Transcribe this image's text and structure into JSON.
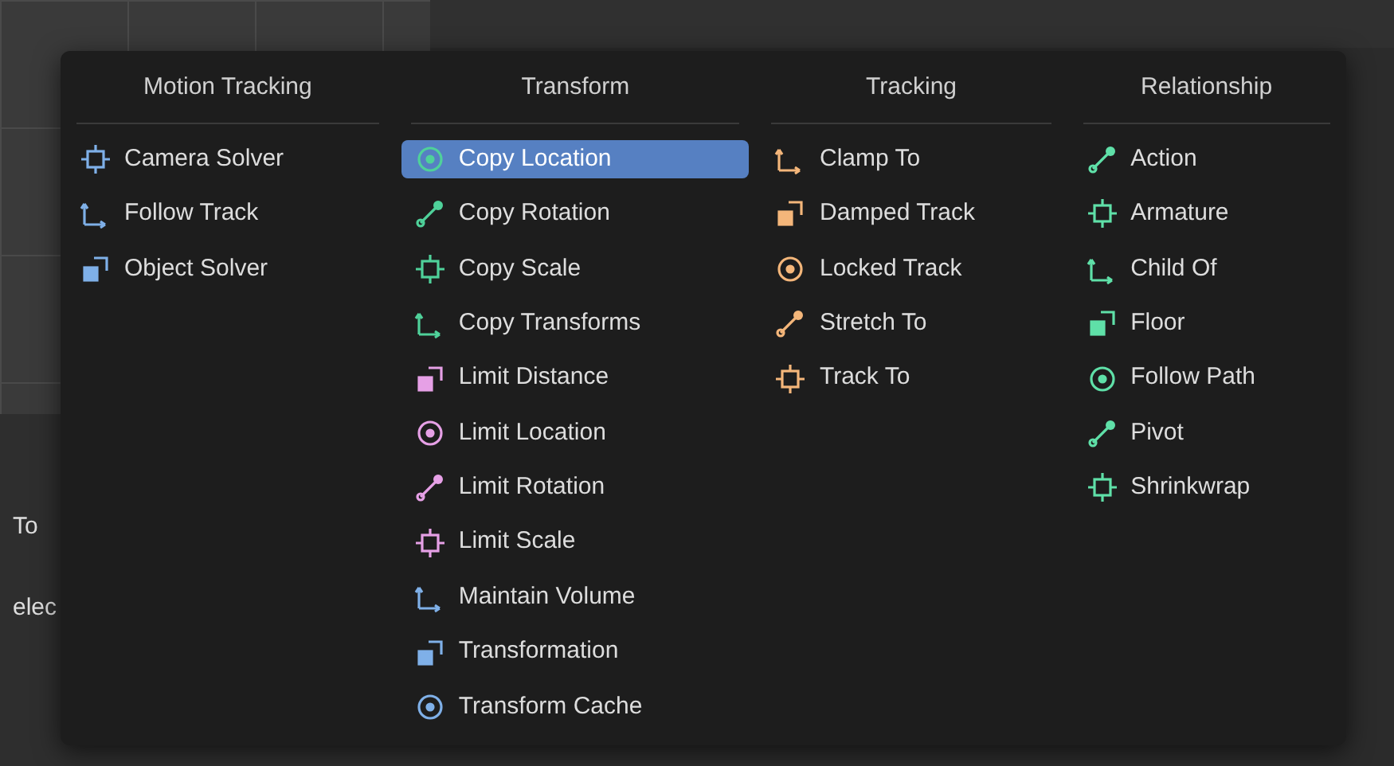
{
  "background": {
    "left_labels": [
      "To",
      "elec"
    ]
  },
  "menu": {
    "columns": [
      {
        "title": "Motion Tracking",
        "items": [
          {
            "label": "Camera Solver",
            "selected": false,
            "color": "#7fb0e8"
          },
          {
            "label": "Follow Track",
            "selected": false,
            "color": "#7fb0e8"
          },
          {
            "label": "Object Solver",
            "selected": false,
            "color": "#7fb0e8"
          }
        ]
      },
      {
        "title": "Transform",
        "items": [
          {
            "label": "Copy Location",
            "selected": true,
            "color": "#4fd19a"
          },
          {
            "label": "Copy Rotation",
            "selected": false,
            "color": "#4fd19a"
          },
          {
            "label": "Copy Scale",
            "selected": false,
            "color": "#4fd19a"
          },
          {
            "label": "Copy Transforms",
            "selected": false,
            "color": "#4fd19a"
          },
          {
            "label": "Limit Distance",
            "selected": false,
            "color": "#e6a0e6"
          },
          {
            "label": "Limit Location",
            "selected": false,
            "color": "#e6a0e6"
          },
          {
            "label": "Limit Rotation",
            "selected": false,
            "color": "#e6a0e6"
          },
          {
            "label": "Limit Scale",
            "selected": false,
            "color": "#e6a0e6"
          },
          {
            "label": "Maintain Volume",
            "selected": false,
            "color": "#7fb0e8"
          },
          {
            "label": "Transformation",
            "selected": false,
            "color": "#7fb0e8"
          },
          {
            "label": "Transform Cache",
            "selected": false,
            "color": "#7fb0e8"
          }
        ]
      },
      {
        "title": "Tracking",
        "items": [
          {
            "label": "Clamp To",
            "selected": false,
            "color": "#f4b67a"
          },
          {
            "label": "Damped Track",
            "selected": false,
            "color": "#f4b67a"
          },
          {
            "label": "Locked Track",
            "selected": false,
            "color": "#f4b67a"
          },
          {
            "label": "Stretch To",
            "selected": false,
            "color": "#f4b67a"
          },
          {
            "label": "Track To",
            "selected": false,
            "color": "#f4b67a"
          }
        ]
      },
      {
        "title": "Relationship",
        "items": [
          {
            "label": "Action",
            "selected": false,
            "color": "#5fe0a8"
          },
          {
            "label": "Armature",
            "selected": false,
            "color": "#5fe0a8"
          },
          {
            "label": "Child Of",
            "selected": false,
            "color": "#5fe0a8"
          },
          {
            "label": "Floor",
            "selected": false,
            "color": "#5fe0a8"
          },
          {
            "label": "Follow Path",
            "selected": false,
            "color": "#5fe0a8"
          },
          {
            "label": "Pivot",
            "selected": false,
            "color": "#5fe0a8"
          },
          {
            "label": "Shrinkwrap",
            "selected": false,
            "color": "#5fe0a8"
          }
        ]
      }
    ]
  }
}
